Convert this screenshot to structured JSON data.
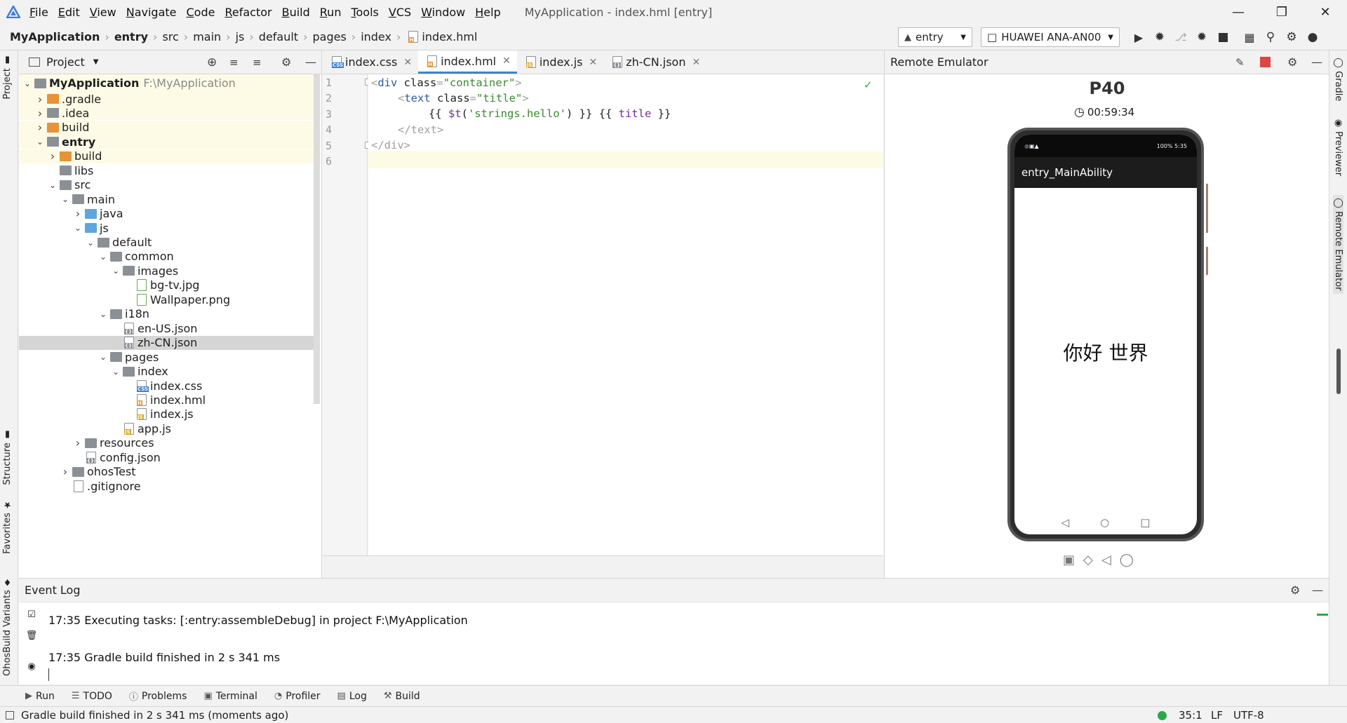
{
  "menu": {
    "items": [
      {
        "mn": "F",
        "rest": "ile"
      },
      {
        "mn": "E",
        "rest": "dit"
      },
      {
        "mn": "V",
        "rest": "iew"
      },
      {
        "mn": "N",
        "rest": "avigate"
      },
      {
        "mn": "C",
        "rest": "ode"
      },
      {
        "mn": "R",
        "rest": "efactor"
      },
      {
        "mn": "B",
        "rest": "uild"
      },
      {
        "mn": "R",
        "rest": "un"
      },
      {
        "mn": "T",
        "rest": "ools"
      },
      {
        "mn": "V",
        "rest": "CS"
      },
      {
        "mn": "W",
        "rest": "indow"
      },
      {
        "mn": "H",
        "rest": "elp"
      }
    ],
    "window_title": "MyApplication - index.hml [entry]"
  },
  "breadcrumb": [
    "MyApplication",
    "entry",
    "src",
    "main",
    "js",
    "default",
    "pages",
    "index",
    "index.hml"
  ],
  "toolbar": {
    "config": "entry",
    "device": "HUAWEI ANA-AN00"
  },
  "left_stripe": {
    "project": "Project",
    "structure": "Structure",
    "favorites": "Favorites",
    "variants": "OhosBuild Variants"
  },
  "right_stripe": {
    "gradle": "Gradle",
    "previewer": "Previewer",
    "remote": "Remote Emulator"
  },
  "project_panel": {
    "title": "Project",
    "root_name": "MyApplication",
    "root_path": "F:\\MyApplication",
    "tree": [
      {
        "label": ".gradle",
        "depth": 1,
        "arrow": "right",
        "icon": "folder-orange"
      },
      {
        "label": ".idea",
        "depth": 1,
        "arrow": "right",
        "icon": "folder-gray"
      },
      {
        "label": "build",
        "depth": 1,
        "arrow": "right",
        "icon": "folder-orange"
      },
      {
        "label": "entry",
        "depth": 1,
        "arrow": "down",
        "icon": "folder-gray",
        "bold": true
      },
      {
        "label": "build",
        "depth": 2,
        "arrow": "right",
        "icon": "folder-orange"
      },
      {
        "label": "libs",
        "depth": 2,
        "arrow": "",
        "icon": "folder-gray"
      },
      {
        "label": "src",
        "depth": 2,
        "arrow": "down",
        "icon": "folder-gray"
      },
      {
        "label": "main",
        "depth": 3,
        "arrow": "down",
        "icon": "folder-gray"
      },
      {
        "label": "java",
        "depth": 4,
        "arrow": "right",
        "icon": "folder-blue"
      },
      {
        "label": "js",
        "depth": 4,
        "arrow": "down",
        "icon": "folder-blue"
      },
      {
        "label": "default",
        "depth": 5,
        "arrow": "down",
        "icon": "folder-gray"
      },
      {
        "label": "common",
        "depth": 6,
        "arrow": "down",
        "icon": "folder-gray"
      },
      {
        "label": "images",
        "depth": 7,
        "arrow": "down",
        "icon": "folder-gray"
      },
      {
        "label": "bg-tv.jpg",
        "depth": 8,
        "arrow": "",
        "icon": "file-img"
      },
      {
        "label": "Wallpaper.png",
        "depth": 8,
        "arrow": "",
        "icon": "file-img"
      },
      {
        "label": "i18n",
        "depth": 6,
        "arrow": "down",
        "icon": "folder-gray"
      },
      {
        "label": "en-US.json",
        "depth": 7,
        "arrow": "",
        "icon": "file-json"
      },
      {
        "label": "zh-CN.json",
        "depth": 7,
        "arrow": "",
        "icon": "file-json",
        "selected": true
      },
      {
        "label": "pages",
        "depth": 6,
        "arrow": "down",
        "icon": "folder-gray"
      },
      {
        "label": "index",
        "depth": 7,
        "arrow": "down",
        "icon": "folder-gray"
      },
      {
        "label": "index.css",
        "depth": 8,
        "arrow": "",
        "icon": "file-css"
      },
      {
        "label": "index.hml",
        "depth": 8,
        "arrow": "",
        "icon": "file-hml"
      },
      {
        "label": "index.js",
        "depth": 8,
        "arrow": "",
        "icon": "file-js"
      },
      {
        "label": "app.js",
        "depth": 7,
        "arrow": "",
        "icon": "file-js"
      },
      {
        "label": "resources",
        "depth": 4,
        "arrow": "right",
        "icon": "folder-gray"
      },
      {
        "label": "config.json",
        "depth": 4,
        "arrow": "",
        "icon": "file-json"
      },
      {
        "label": "ohosTest",
        "depth": 3,
        "arrow": "right",
        "icon": "folder-gray"
      },
      {
        "label": ".gitignore",
        "depth": 3,
        "arrow": "",
        "icon": "file-plain"
      }
    ]
  },
  "editor": {
    "tabs": [
      {
        "label": "index.css",
        "icon": "file-css",
        "active": false
      },
      {
        "label": "index.hml",
        "icon": "file-hml",
        "active": true
      },
      {
        "label": "index.js",
        "icon": "file-js",
        "active": false
      },
      {
        "label": "zh-CN.json",
        "icon": "file-json",
        "active": false
      }
    ],
    "line_numbers": [
      "1",
      "2",
      "3",
      "4",
      "5",
      "6"
    ],
    "code": {
      "l1_open": "<",
      "l1_tag": "div",
      "l1_attr": " class",
      "l1_eq": "=",
      "l1_val": "\"container\"",
      "l1_close": ">",
      "l2_open": "<",
      "l2_tag": "text",
      "l2_attr": " class",
      "l2_eq": "=",
      "l2_val": "\"title\"",
      "l2_close": ">",
      "l3_b1": "{{ ",
      "l3_fn": "$t",
      "l3_p1": "(",
      "l3_str": "'strings.hello'",
      "l3_p2": ")",
      "l3_b2": " }} {{ ",
      "l3_var": "title",
      "l3_b3": " }}",
      "l4_text": "</text>",
      "l5_text": "</div>"
    }
  },
  "emulator": {
    "header": "Remote Emulator",
    "device_name": "P40",
    "timer": "00:59:34",
    "status_right": "100% 5:35",
    "app_title": "entry_MainAbility",
    "content_text": "你好 世界"
  },
  "event_log": {
    "title": "Event Log",
    "lines": [
      "17:35  Executing tasks: [:entry:assembleDebug] in project F:\\MyApplication",
      "17:35  Gradle build finished in 2 s 341 ms"
    ]
  },
  "bottom_tabs": [
    "Run",
    "TODO",
    "Problems",
    "Terminal",
    "Profiler",
    "Log",
    "Build"
  ],
  "status_bar": {
    "message": "Gradle build finished in 2 s 341 ms (moments ago)",
    "position": "35:1",
    "line_sep": "LF",
    "encoding": "UTF-8"
  },
  "colors": {
    "accent": "#4083c9",
    "ok_green": "#2aa84a",
    "stop_red": "#e04545"
  }
}
